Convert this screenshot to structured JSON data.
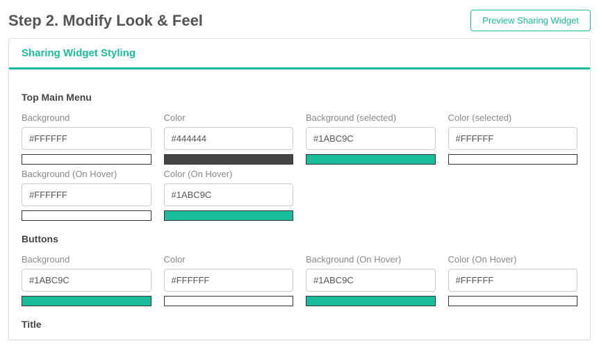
{
  "header": {
    "title": "Step 2. Modify Look & Feel",
    "preview_button": "Preview Sharing Widget"
  },
  "panel": {
    "title": "Sharing Widget Styling"
  },
  "sections": {
    "top_main_menu": {
      "title": "Top Main Menu",
      "fields": {
        "background": {
          "label": "Background",
          "value": "#FFFFFF",
          "swatch": "#FFFFFF"
        },
        "color": {
          "label": "Color",
          "value": "#444444",
          "swatch": "#444444"
        },
        "background_selected": {
          "label": "Background (selected)",
          "value": "#1ABC9C",
          "swatch": "#1ABC9C"
        },
        "color_selected": {
          "label": "Color (selected)",
          "value": "#FFFFFF",
          "swatch": "#FFFFFF"
        },
        "background_hover": {
          "label": "Background (On Hover)",
          "value": "#FFFFFF",
          "swatch": "#FFFFFF"
        },
        "color_hover": {
          "label": "Color (On Hover)",
          "value": "#1ABC9C",
          "swatch": "#1ABC9C"
        }
      }
    },
    "buttons": {
      "title": "Buttons",
      "fields": {
        "background": {
          "label": "Background",
          "value": "#1ABC9C",
          "swatch": "#1ABC9C"
        },
        "color": {
          "label": "Color",
          "value": "#FFFFFF",
          "swatch": "#FFFFFF"
        },
        "background_hover": {
          "label": "Background (On Hover)",
          "value": "#1ABC9C",
          "swatch": "#1ABC9C"
        },
        "color_hover": {
          "label": "Color (On Hover)",
          "value": "#FFFFFF",
          "swatch": "#FFFFFF"
        }
      }
    },
    "title_section": {
      "title": "Title"
    }
  }
}
